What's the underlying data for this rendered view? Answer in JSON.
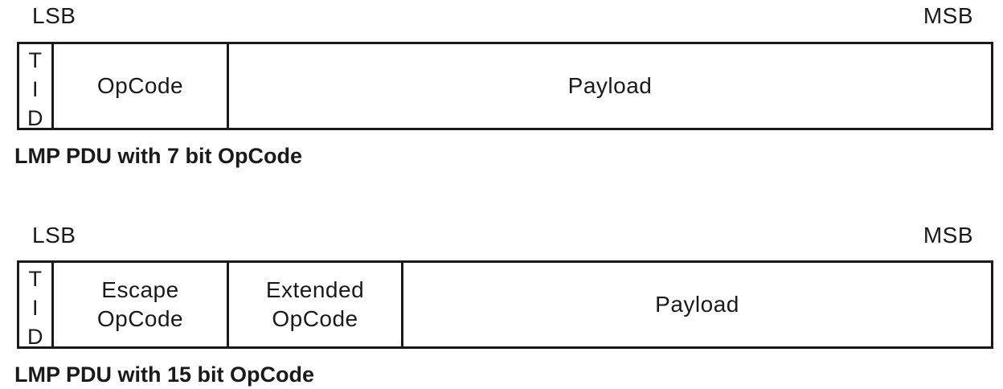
{
  "diagrams": [
    {
      "lsb": "LSB",
      "msb": "MSB",
      "tid": [
        "T",
        "I",
        "D"
      ],
      "fields": [
        {
          "lines": [
            "OpCode"
          ]
        },
        {
          "lines": [
            "Payload"
          ]
        }
      ],
      "caption": "LMP PDU with 7 bit OpCode"
    },
    {
      "lsb": "LSB",
      "msb": "MSB",
      "tid": [
        "T",
        "I",
        "D"
      ],
      "fields": [
        {
          "lines": [
            "Escape",
            "OpCode"
          ]
        },
        {
          "lines": [
            "Extended",
            "OpCode"
          ]
        },
        {
          "lines": [
            "Payload"
          ]
        }
      ],
      "caption": "LMP PDU with 15 bit OpCode"
    }
  ]
}
